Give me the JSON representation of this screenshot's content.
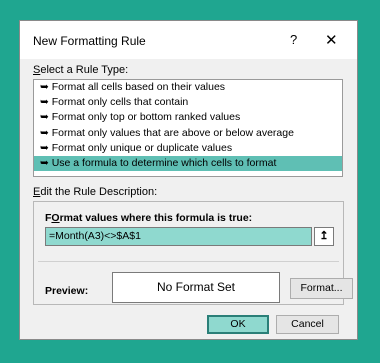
{
  "dialog": {
    "title": "New Formatting Rule",
    "help_label": "?",
    "close_label": "✕"
  },
  "rule_type": {
    "label_prefix": "S",
    "label_rest": "elect a Rule Type:",
    "items": [
      "➥ Format all cells based on their values",
      "➥ Format only cells that contain",
      "➥ Format only top or bottom ranked values",
      "➥ Format only values that are above or below average",
      "➥ Format only unique or duplicate values",
      "➥ Use a formula to determine which cells to format"
    ],
    "selected_index": 5
  },
  "description": {
    "label_prefix": "E",
    "label_rest": "dit the Rule Description:",
    "formula_label_prefix": "O",
    "formula_label_before": "F",
    "formula_label_rest": "rmat values where this formula is true:",
    "formula_value": "=Month(A3)<>$A$1",
    "collapse_icon": "↥"
  },
  "preview": {
    "label": "Preview:",
    "text": "No Format Set",
    "format_button": "Format..."
  },
  "buttons": {
    "ok": "OK",
    "cancel": "Cancel"
  }
}
